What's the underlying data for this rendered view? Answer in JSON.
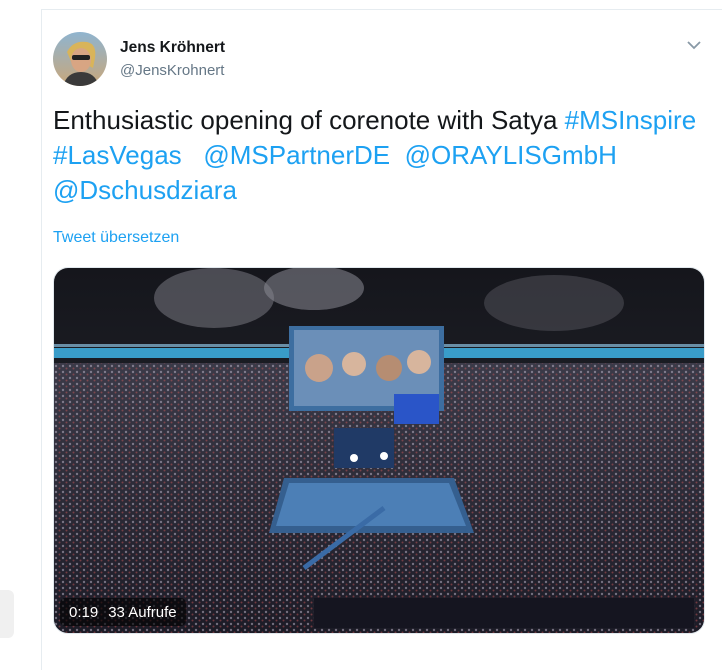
{
  "author": {
    "name": "Jens Kröhnert",
    "handle": "@JensKrohnert"
  },
  "tweet": {
    "text_plain_1": "Enthusiastic opening of corenote with Satya ",
    "hashtag_1": "#MSInspire",
    "hashtag_2": "#LasVegas",
    "mention_1": "@MSPartnerDE",
    "mention_2": "@ORAYLISGmbH",
    "mention_3": "@Dschusdziara"
  },
  "translate_label": "Tweet übersetzen",
  "video": {
    "duration": "0:19",
    "views": "33 Aufrufe"
  },
  "colors": {
    "link": "#1da1f2",
    "text": "#14171a",
    "muted": "#657786"
  },
  "icons": {
    "menu": "chevron-down-icon"
  }
}
